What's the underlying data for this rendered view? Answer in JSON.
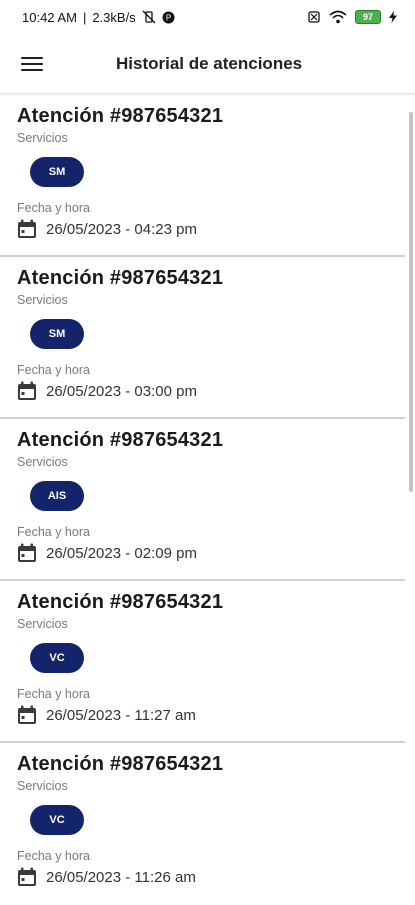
{
  "status_bar": {
    "time": "10:42 AM",
    "speed": "2.3kB/s",
    "battery": "97"
  },
  "app_bar": {
    "title": "Historial de atenciones",
    "menu_icon": "hamburger-menu-icon"
  },
  "records": [
    {
      "title": "Atención #987654321",
      "services_label": "Servicios",
      "service_code": "SM",
      "datetime_label": "Fecha y hora",
      "datetime": "26/05/2023 - 04:23 pm"
    },
    {
      "title": "Atención #987654321",
      "services_label": "Servicios",
      "service_code": "SM",
      "datetime_label": "Fecha y hora",
      "datetime": "26/05/2023 - 03:00 pm"
    },
    {
      "title": "Atención #987654321",
      "services_label": "Servicios",
      "service_code": "AIS",
      "datetime_label": "Fecha y hora",
      "datetime": "26/05/2023 - 02:09 pm"
    },
    {
      "title": "Atención #987654321",
      "services_label": "Servicios",
      "service_code": "VC",
      "datetime_label": "Fecha y hora",
      "datetime": "26/05/2023 - 11:27 am"
    },
    {
      "title": "Atención #987654321",
      "services_label": "Servicios",
      "service_code": "VC",
      "datetime_label": "Fecha y hora",
      "datetime": "26/05/2023 - 11:26 am"
    }
  ],
  "colors": {
    "chip_background": "#13246b",
    "divider": "#d0d0d0",
    "label_gray": "#7a7a7a"
  }
}
